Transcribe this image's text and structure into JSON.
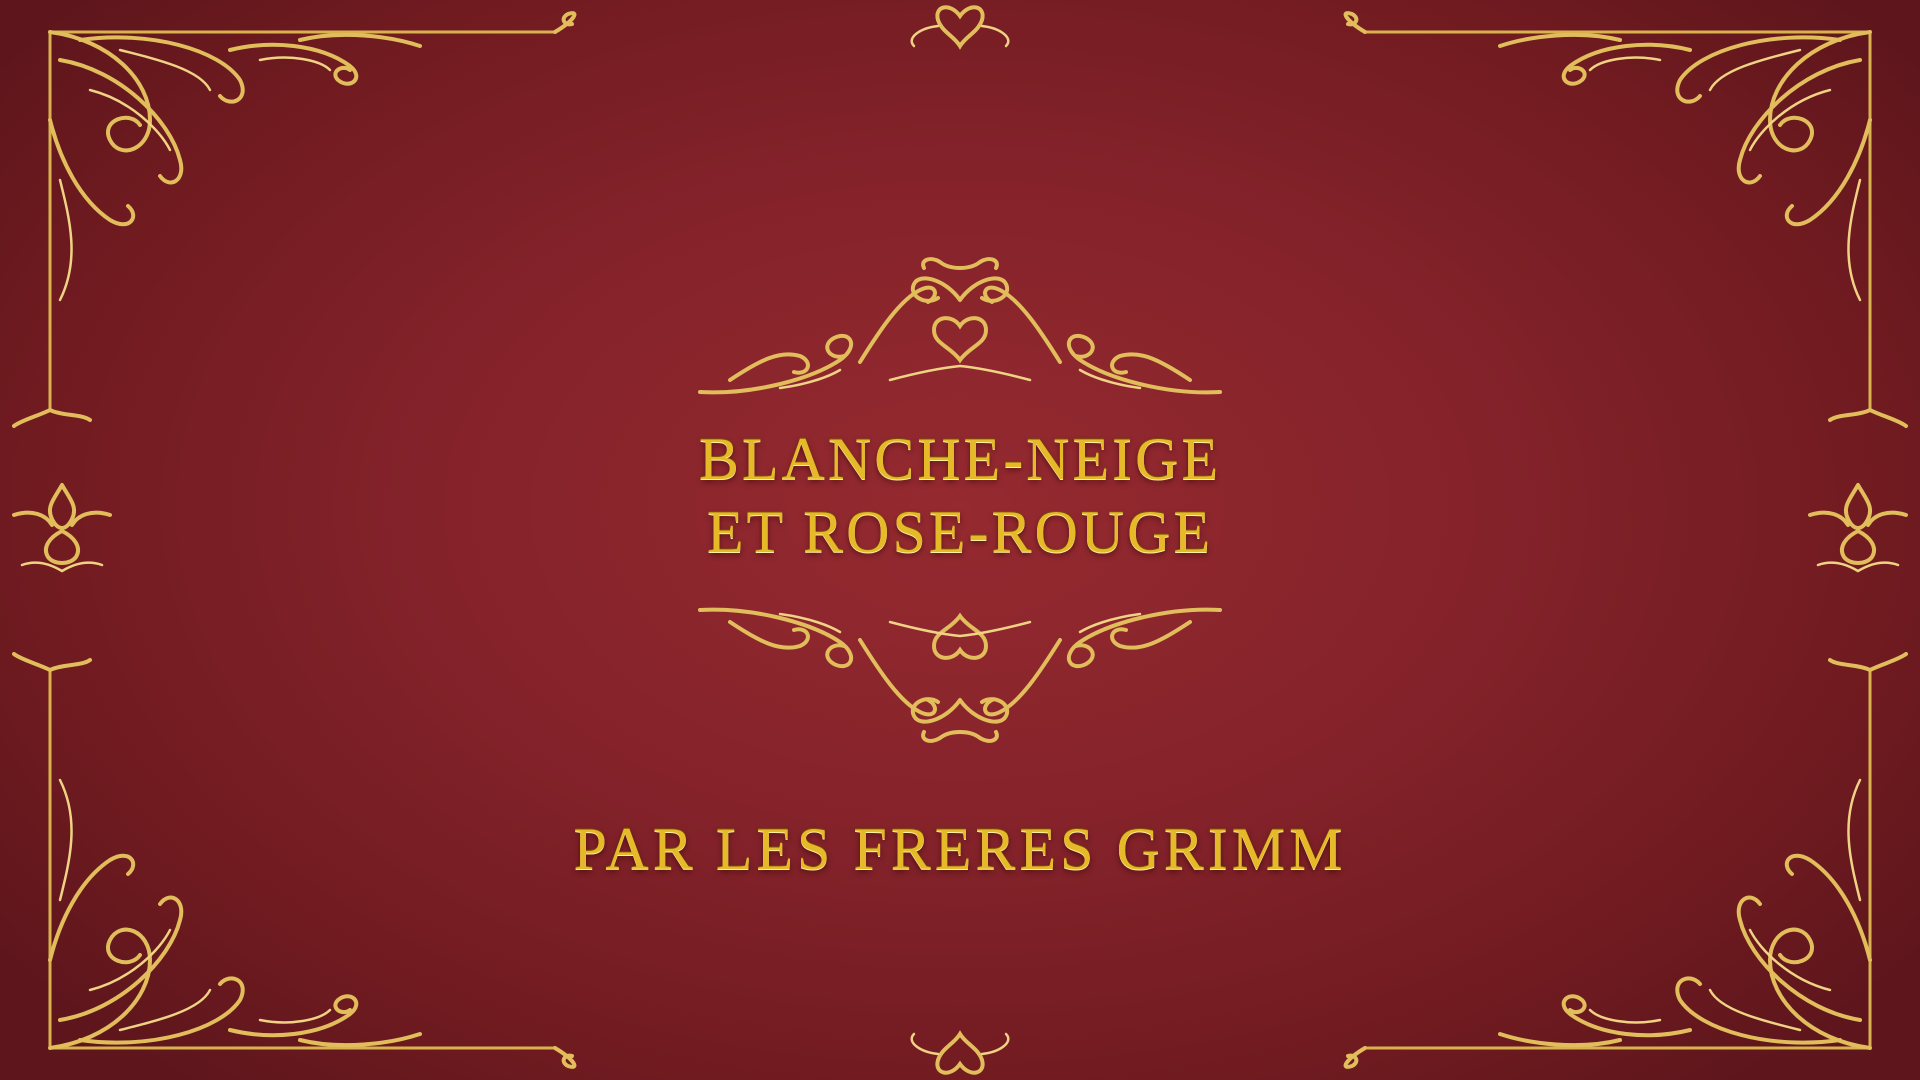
{
  "title": {
    "line1": "BLANCHE-NEIGE",
    "line2": "ET ROSE-ROUGE"
  },
  "author": "PAR LES FRERES GRIMM",
  "colors": {
    "background_center": "#952a30",
    "background_edge": "#5e161c",
    "gold": "#e6b929",
    "gold_light": "#efd283"
  },
  "ornaments": [
    "corner-flourish",
    "title-flourish",
    "side-flourish",
    "heart-flourish"
  ]
}
